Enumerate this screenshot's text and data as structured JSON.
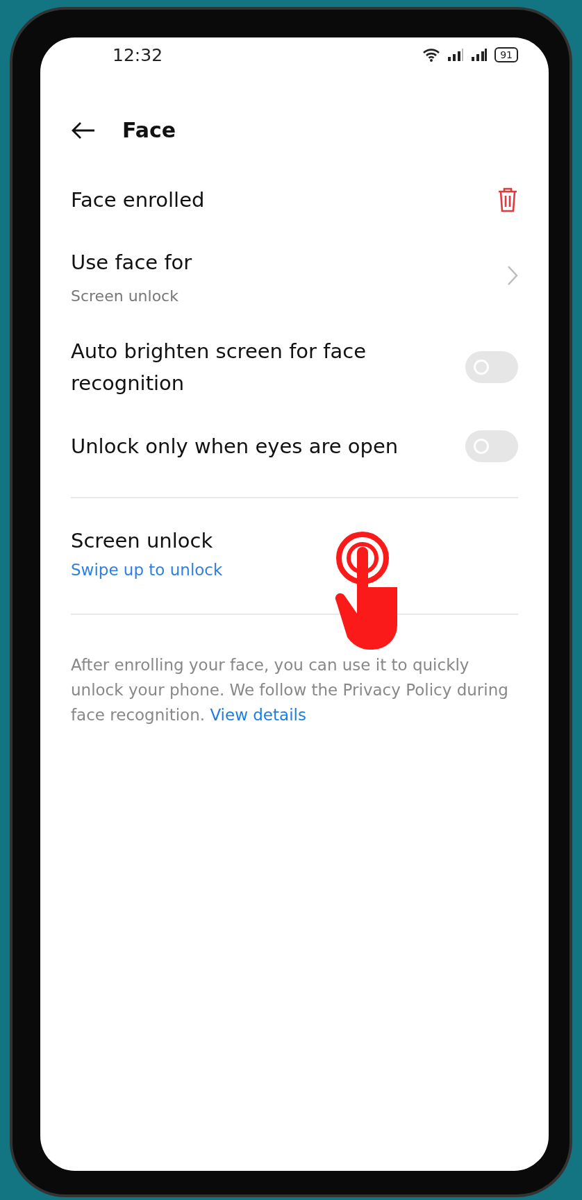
{
  "status_bar": {
    "time": "12:32",
    "battery": "91"
  },
  "header": {
    "title": "Face"
  },
  "items": [
    {
      "kind": "action",
      "title": "Face enrolled"
    },
    {
      "kind": "link",
      "title": "Use face for",
      "subtitle": "Screen unlock"
    },
    {
      "kind": "toggle",
      "title": "Auto brighten screen for face recognition",
      "on": false
    },
    {
      "kind": "toggle",
      "title": "Unlock only when eyes are open",
      "on": false
    }
  ],
  "screen_unlock": {
    "title": "Screen unlock",
    "value": "Swipe up to unlock"
  },
  "footer": {
    "text": "After enrolling your face, you can use it to quickly unlock your phone. We follow the Privacy Policy during face recognition.",
    "link": "View details"
  }
}
